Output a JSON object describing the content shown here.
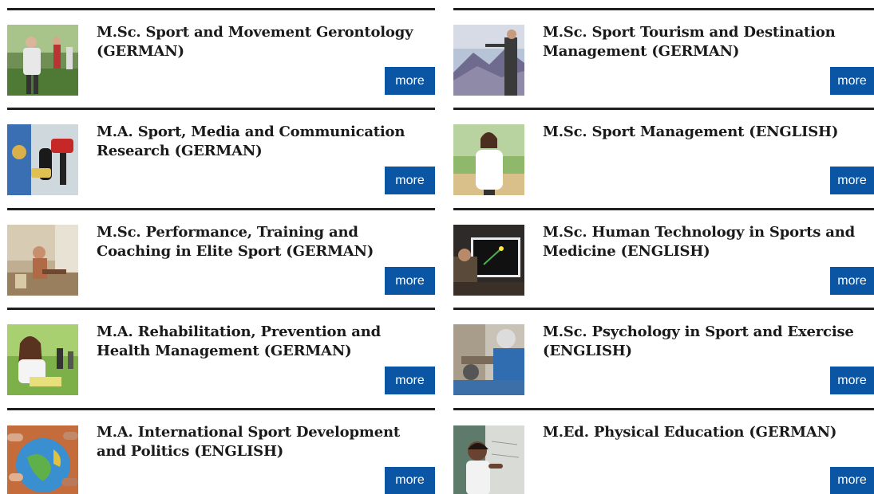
{
  "programs": [
    {
      "title": "M.Sc. Sport and Movement Gerontology (GERMAN)",
      "more_label": "more",
      "image": "group-exercise-outdoors"
    },
    {
      "title": "M.Sc. Sport Tourism and Destination Management (GERMAN)",
      "more_label": "more",
      "image": "mountain-viewpoint"
    },
    {
      "title": "M.A. Sport, Media and Communication Research (GERMAN)",
      "more_label": "more",
      "image": "microphones-interview"
    },
    {
      "title": "M.Sc. Sport Management (ENGLISH)",
      "more_label": "more",
      "image": "woman-portrait-stadium"
    },
    {
      "title": "M.Sc. Performance, Training and Coaching in Elite Sport (GERMAN)",
      "more_label": "more",
      "image": "athlete-training-gym"
    },
    {
      "title": "M.Sc. Human Technology in Sports and Medicine (ENGLISH)",
      "more_label": "more",
      "image": "screen-analysis-lab"
    },
    {
      "title": "M.A. Rehabilitation, Prevention and Health Management (GERMAN)",
      "more_label": "more",
      "image": "woman-reading-outdoors"
    },
    {
      "title": "M.Sc. Psychology in Sport and Exercise (ENGLISH)",
      "more_label": "more",
      "image": "eeg-cap-experiment"
    },
    {
      "title": "M.A. International Sport Development and Politics (ENGLISH)",
      "more_label": "more",
      "image": "hands-on-globe"
    },
    {
      "title": "M.Ed. Physical Education (GERMAN)",
      "more_label": "more",
      "image": "student-at-board"
    }
  ],
  "colors": {
    "button_bg": "#0b56a4",
    "button_text": "#ffffff",
    "divider": "#1f1f1f",
    "title_text": "#1a1a1a"
  }
}
